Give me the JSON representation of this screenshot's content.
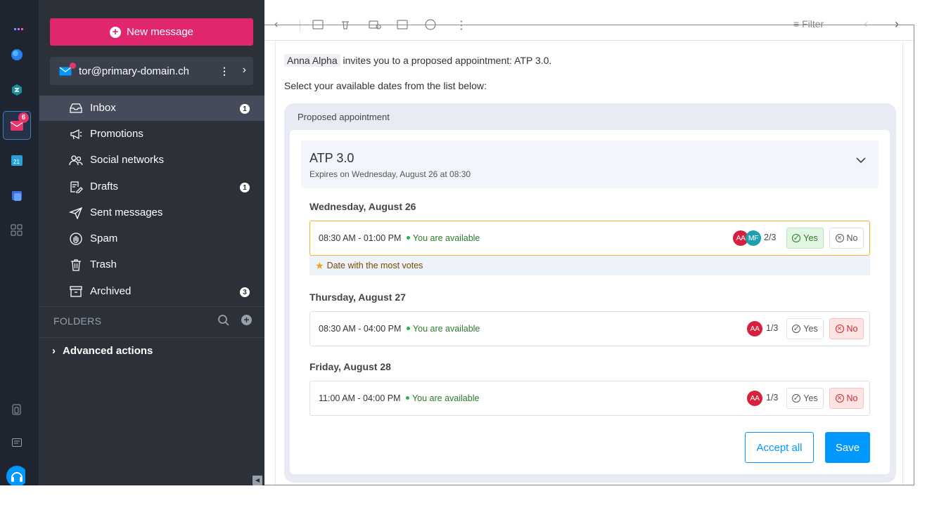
{
  "rail": {
    "badge": "6",
    "icons": [
      "kdrive-icon",
      "kchat-icon",
      "mail-icon",
      "calendar-icon",
      "contacts-icon",
      "apps-grid-icon",
      "devices-icon",
      "feedback-icon",
      "support-icon"
    ]
  },
  "sidebar": {
    "new_message": "New message",
    "account": "tor@primary-domain.ch",
    "items": [
      {
        "label": "Inbox",
        "count": "1",
        "icon": "inbox-icon"
      },
      {
        "label": "Promotions",
        "count": "",
        "icon": "megaphone-icon"
      },
      {
        "label": "Social networks",
        "count": "",
        "icon": "people-icon"
      },
      {
        "label": "Drafts",
        "count": "1",
        "icon": "draft-icon"
      },
      {
        "label": "Sent messages",
        "count": "",
        "icon": "send-icon"
      },
      {
        "label": "Spam",
        "count": "",
        "icon": "spam-hand-icon"
      },
      {
        "label": "Trash",
        "count": "",
        "icon": "trash-icon"
      },
      {
        "label": "Archived",
        "count": "3",
        "icon": "archive-icon"
      }
    ],
    "folders_label": "FOLDERS",
    "advanced_actions": "Advanced actions"
  },
  "toolbar": {
    "filter": "Filter"
  },
  "message": {
    "organizer": "Anna Alpha",
    "invite_text": "invites you to a proposed appointment: ATP 3.0.",
    "select_text": "Select your available dates from the list below:",
    "card_title": "Proposed appointment",
    "event_title": "ATP 3.0",
    "expires": "Expires on Wednesday, August 26 at 08:30",
    "most_votes": "Date with the most votes",
    "days": [
      {
        "label": "Wednesday, August 26",
        "time": "08:30 AM - 01:00 PM",
        "availability": "You are available",
        "avatars": [
          "AA",
          "MF"
        ],
        "votes": "2/3",
        "yes": "Yes",
        "no": "No",
        "choice": "yes"
      },
      {
        "label": "Thursday, August 27",
        "time": "08:30 AM - 04:00 PM",
        "availability": "You are available",
        "avatars": [
          "AA"
        ],
        "votes": "1/3",
        "yes": "Yes",
        "no": "No",
        "choice": "no"
      },
      {
        "label": "Friday, August 28",
        "time": "11:00 AM - 04:00 PM",
        "availability": "You are available",
        "avatars": [
          "AA"
        ],
        "votes": "1/3",
        "yes": "Yes",
        "no": "No",
        "choice": "no"
      }
    ],
    "accept_all": "Accept all",
    "save": "Save"
  },
  "colors": {
    "brand_pink": "#e0266f",
    "primary_blue": "#0098ff",
    "sidebar_bg": "#2b3039",
    "rail_bg": "#1f2530"
  }
}
